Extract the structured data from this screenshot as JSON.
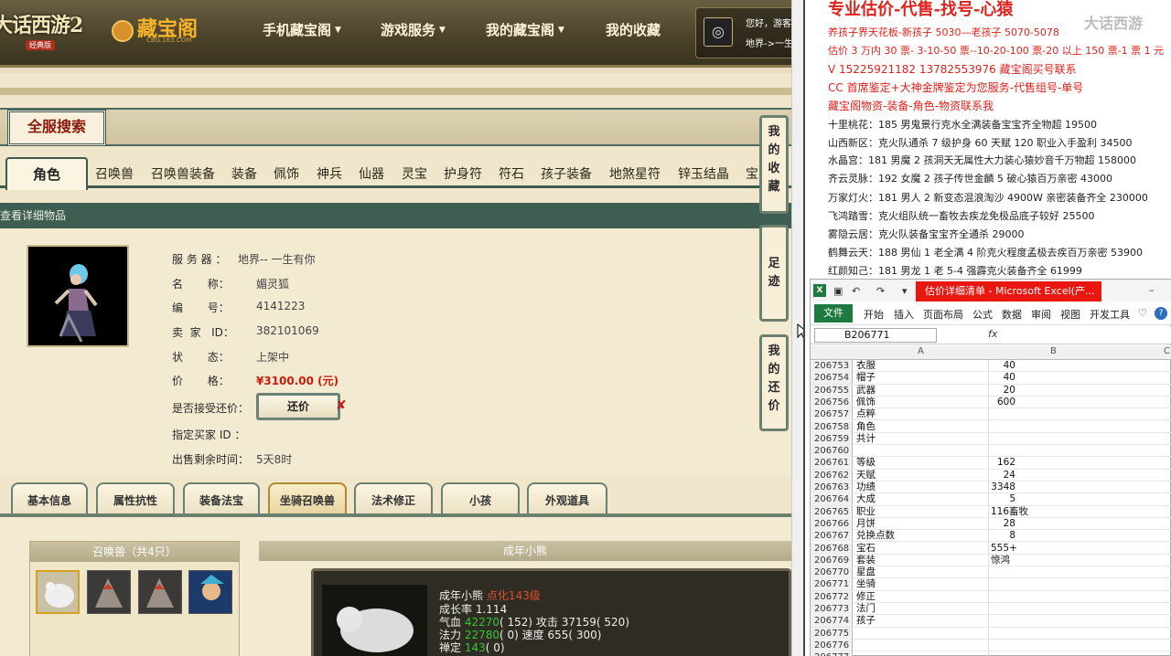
{
  "site": {
    "game_logo": "大话西游2",
    "game_logo_sub": "经典版",
    "cbg_logo": "藏宝阁",
    "cbg_logo_sub": "CBG.163.COM",
    "nav": [
      "手机藏宝阁",
      "游戏服务",
      "我的藏宝阁",
      "我的收藏"
    ],
    "user_greeting": "您好，游客",
    "user_server": "地界->一生"
  },
  "search": {
    "title": "全服搜索"
  },
  "tabs": [
    "角色",
    "召唤兽",
    "召唤兽装备",
    "装备",
    "佩饰",
    "神兵",
    "仙器",
    "灵宝",
    "护身符",
    "符石",
    "孩子装备",
    "地煞星符",
    "锌玉结晶",
    "宝"
  ],
  "detail": {
    "header": "查看详细物品",
    "fields": [
      {
        "label": "服 务 器 ：",
        "value": "地界-- 一生有你"
      },
      {
        "label": "名       称：",
        "value": "媚灵狐"
      },
      {
        "label": "编       号：",
        "value": "4141223"
      },
      {
        "label": "卖  家   ID：",
        "value": "382101069"
      },
      {
        "label": "状       态：",
        "value": "上架中"
      },
      {
        "label": "价       格：",
        "value": "¥3100.00 (元)"
      },
      {
        "label": "是否接受还价：",
        "value": ""
      },
      {
        "label": "指定买家 ID ：",
        "value": ""
      },
      {
        "label": "出售剩余时间：",
        "value": "5天8时"
      }
    ],
    "counter_offer": "还价",
    "counter_x": "✘"
  },
  "side_buttons": [
    [
      "我",
      "的",
      "收",
      "藏"
    ],
    [
      "足",
      "迹"
    ],
    [
      "我",
      "的",
      "还",
      "价"
    ]
  ],
  "subtabs": [
    "基本信息",
    "属性抗性",
    "装备法宝",
    "坐骑召唤兽",
    "法术修正",
    "小孩",
    "外观道具"
  ],
  "pets": {
    "panel_title": "召唤兽（共4只）",
    "young_title": "成年小熊",
    "young_name": "成年小熊",
    "young_level": "点化143级",
    "stats": [
      {
        "label": "成长率",
        "g": "1.114",
        "r": ""
      },
      {
        "label": "气血",
        "g": "42270",
        "r": "( 152) 攻击 37159( 520)"
      },
      {
        "label": "法力",
        "g": "22780",
        "r": "( 0) 速度 655( 300)"
      },
      {
        "label": "禅定",
        "g": "143",
        "r": "( 0)"
      }
    ]
  },
  "right_note": {
    "title": "专业估价-代售-找号-心猿",
    "watermark": "大话西游",
    "lines": [
      {
        "text": "养孩子界天花板-新孩子 5030—老孩子 5070-5078",
        "red": true
      },
      {
        "text": "估价 3 万内 30 票- 3-10-50 票--10-20-100 票-20 以上 150 票-1 票 1 元",
        "red": true
      },
      {
        "text": "V 15225921182      13782553976    藏宝阁买号联系",
        "red": true
      },
      {
        "text": "CC 首席鉴定+大神金牌鉴定为您服务-代售组号-单号",
        "red": true
      },
      {
        "text": "藏宝阁物资-装备-角色-物资联系我",
        "red": true
      },
      {
        "text": "十里桃花：185 男鬼景行克水全满装备宝宝齐全物超 19500",
        "red": false
      },
      {
        "text": "山西新区：克火队通杀 7 级护身 60 天赋 120 职业入手盈利 34500",
        "red": false
      },
      {
        "text": "水晶宫：181 男魔 2 孩洞天无属性大力装心猿妙音千万物超 158000",
        "red": false
      },
      {
        "text": "齐云灵脉：192 女魔 2 孩子传世金麟 5 破心猿百万亲密 43000",
        "red": false
      },
      {
        "text": "万家灯火：181 男人 2 新变态混浪淘沙 4900W 亲密装备齐全 230000",
        "red": false
      },
      {
        "text": "飞鸿踏雪：克火组队统一畜牧去疾龙免极品底子较好 25500",
        "red": false
      },
      {
        "text": "雾隐云居：克火队装备宝宝齐全通杀 29000",
        "red": false
      },
      {
        "text": "鹤舞云天：188 男仙 1 老全满 4 阶克火程度孟极去疾百万亲密 53900",
        "red": false
      },
      {
        "text": "红颜知己：181 男龙 1 老 5-4 强霹克火装备齐全 61999",
        "red": false
      }
    ]
  },
  "excel": {
    "title": "估价详细清单 - Microsoft Excel(产...",
    "menu": [
      "开始",
      "插入",
      "页面布局",
      "公式",
      "数据",
      "审阅",
      "视图",
      "开发工具"
    ],
    "file_tab": "文件",
    "name_box": "B206771",
    "fx": "fx",
    "columns": [
      "A",
      "B",
      "C"
    ],
    "rows": [
      {
        "n": "206753",
        "a": "衣服",
        "b": "40"
      },
      {
        "n": "206754",
        "a": "帽子",
        "b": "40"
      },
      {
        "n": "206755",
        "a": "武器",
        "b": "20"
      },
      {
        "n": "206756",
        "a": "佩饰",
        "b": "600"
      },
      {
        "n": "206757",
        "a": "点粹",
        "b": ""
      },
      {
        "n": "206758",
        "a": "角色",
        "b": ""
      },
      {
        "n": "206759",
        "a": "共计",
        "b": ""
      },
      {
        "n": "206760",
        "a": "",
        "b": ""
      },
      {
        "n": "206761",
        "a": "等级",
        "b": "162"
      },
      {
        "n": "206762",
        "a": "天赋",
        "b": "24"
      },
      {
        "n": "206763",
        "a": "功绩",
        "b": "3348"
      },
      {
        "n": "206764",
        "a": "大成",
        "b": "5"
      },
      {
        "n": "206765",
        "a": "职业",
        "t": "116畜牧"
      },
      {
        "n": "206766",
        "a": "月饼",
        "b": "28"
      },
      {
        "n": "206767",
        "a": "兑换点数",
        "b": "8"
      },
      {
        "n": "206768",
        "a": "宝石",
        "t": "555+"
      },
      {
        "n": "206769",
        "a": "套装",
        "t": "惊鸿"
      },
      {
        "n": "206770",
        "a": "星盘",
        "b": ""
      },
      {
        "n": "206771",
        "a": "坐骑",
        "b": ""
      },
      {
        "n": "206772",
        "a": "修正",
        "b": ""
      },
      {
        "n": "206773",
        "a": "法门",
        "b": ""
      },
      {
        "n": "206774",
        "a": "孩子",
        "b": ""
      },
      {
        "n": "206775",
        "a": "",
        "b": ""
      },
      {
        "n": "206776",
        "a": "",
        "b": ""
      },
      {
        "n": "206777",
        "a": "",
        "b": ""
      }
    ]
  }
}
